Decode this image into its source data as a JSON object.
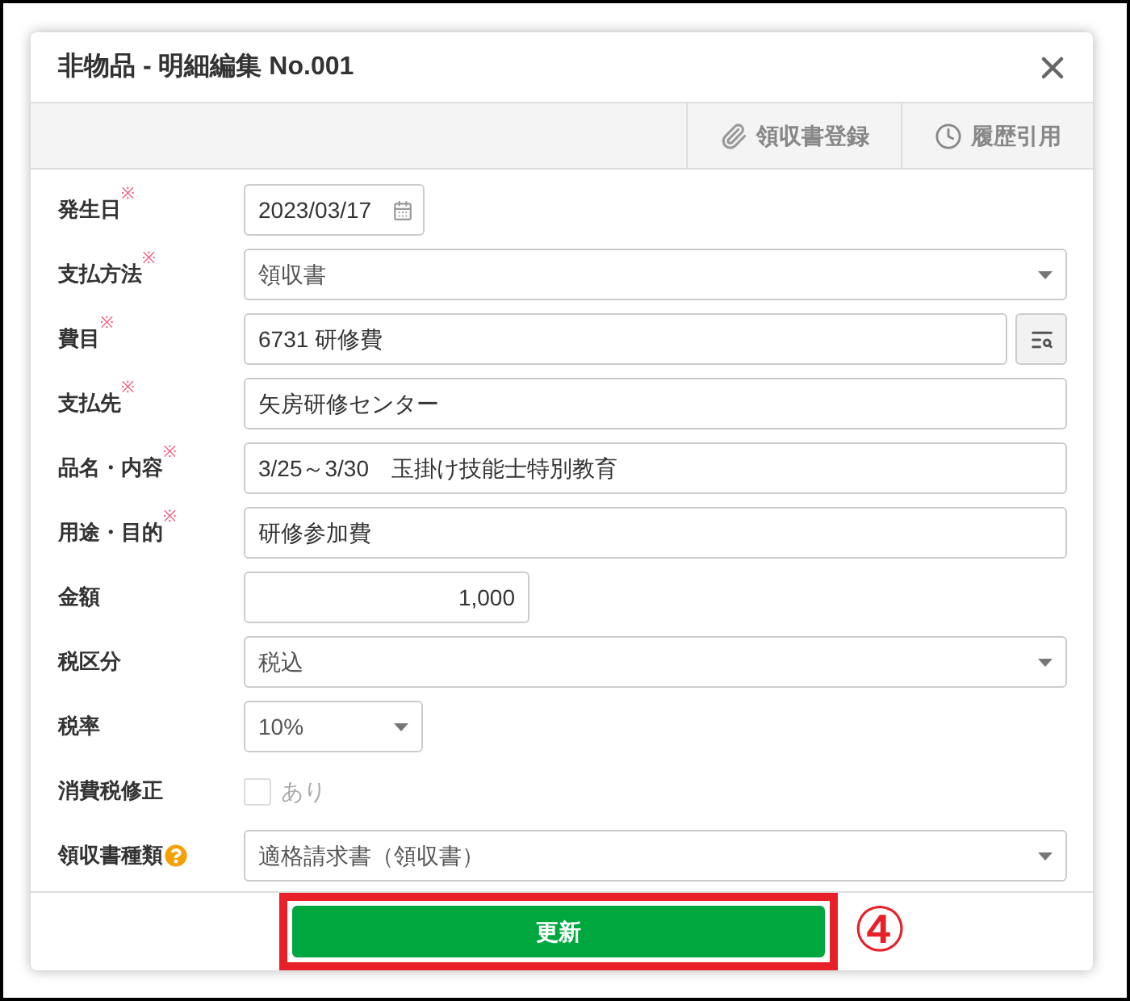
{
  "dialog": {
    "title": "非物品 - 明細編集 No.001"
  },
  "toolbar": [
    {
      "kind": "attach",
      "label": "領収書登録"
    },
    {
      "kind": "history",
      "label": "履歴引用"
    }
  ],
  "fields": [
    {
      "kind": "date",
      "label": "発生日",
      "required_mark": "※",
      "value": "2023/03/17"
    },
    {
      "kind": "select",
      "label": "支払方法",
      "required_mark": "※",
      "value": "領収書"
    },
    {
      "kind": "lookup",
      "label": "費目",
      "required_mark": "※",
      "value": "6731 研修費"
    },
    {
      "kind": "text",
      "label": "支払先",
      "required_mark": "※",
      "value": "矢房研修センター"
    },
    {
      "kind": "text",
      "label": "品名・内容",
      "required_mark": "※",
      "value": "3/25～3/30　玉掛け技能士特別教育"
    },
    {
      "kind": "text",
      "label": "用途・目的",
      "required_mark": "※",
      "value": "研修参加費"
    },
    {
      "kind": "amount",
      "label": "金額",
      "value": "1,000"
    },
    {
      "kind": "select",
      "label": "税区分",
      "value": "税込"
    },
    {
      "kind": "select_short",
      "label": "税率",
      "value": "10%"
    },
    {
      "kind": "checkbox",
      "label": "消費税修正",
      "option": "あり",
      "checked": false,
      "disabled": true
    },
    {
      "kind": "select",
      "label": "領収書種類",
      "help": true,
      "value": "適格請求書（領収書）"
    }
  ],
  "footer": {
    "button": "更新",
    "highlighted": true,
    "step": "④"
  }
}
